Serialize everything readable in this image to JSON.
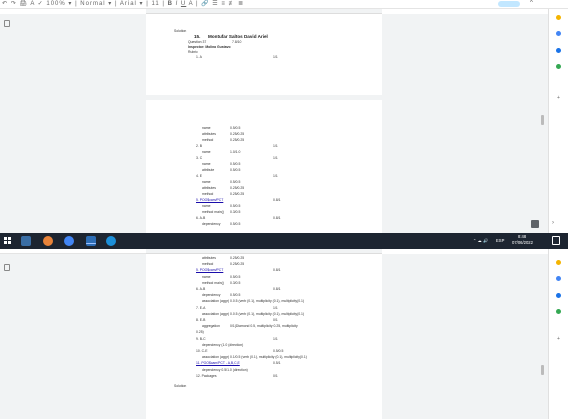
{
  "top_window": {
    "doc": {
      "solution_label": "Solution",
      "question_number": "15.",
      "student_name": "Montufar Saltos David Ariel",
      "question_line": "Question 37",
      "score": "7.8/10",
      "inspector": "Inspector: Molina Gustavo",
      "rubric": "Rubric",
      "item1_label": "1.  A",
      "item1_score": "1/1"
    },
    "page2_lines": [
      {
        "t": "name",
        "v": "0.5/0.5"
      },
      {
        "t": "attributes",
        "v": "0.25/0.25"
      },
      {
        "t": "method",
        "v": "0.25/0.25"
      },
      {
        "t": "2.  B",
        "v": "",
        "s": "1/1"
      },
      {
        "t": "name",
        "v": "1.0/1.0"
      },
      {
        "t": "3.  C",
        "v": "",
        "s": "1/1"
      },
      {
        "t": "name",
        "v": "0.5/0.5"
      },
      {
        "t": "attribute",
        "v": "0.5/0.5"
      },
      {
        "t": "4.  E",
        "v": "",
        "s": "1/1"
      },
      {
        "t": "name",
        "v": "0.5/0.5"
      },
      {
        "t": "attributes",
        "v": "0.25/0.25"
      },
      {
        "t": "method",
        "v": "0.25/0.25"
      },
      {
        "t": "5.  POO$cam/PCT",
        "v": "",
        "s": "0.8/1",
        "link": true
      },
      {
        "t": "name",
        "v": "0.5/0.5"
      },
      {
        "t": "method main()",
        "v": "0.3/0.5"
      },
      {
        "t": "6.  A-B",
        "v": "",
        "s": "0.8/1"
      },
      {
        "t": "dependency",
        "v": "0.5/0.5"
      }
    ]
  },
  "taskbar": {
    "lang": "ESP",
    "time": "8:48",
    "date": "07/06/2022"
  },
  "bottom_window": {
    "lines": [
      {
        "t": "attributes",
        "v": "0.25/0.25"
      },
      {
        "t": "method",
        "v": "0.25/0.25"
      },
      {
        "t": "5.  POO$cam/PCT",
        "v": "",
        "s": "0.8/1",
        "link": true
      },
      {
        "t": "name",
        "v": "0.5/0.5"
      },
      {
        "t": "method main()",
        "v": "0.3/0.5"
      },
      {
        "t": "6.  A-B",
        "v": "",
        "s": "0.8/1"
      },
      {
        "t": "dependency",
        "v": "0.5/0.5"
      },
      {
        "t": "association (aggr)",
        "v": "0.0.5 (verb (0.1), multiplicity (0.1), multiplicity(0.1)"
      },
      {
        "t": "7.  E-A",
        "v": "",
        "s": "1/1"
      },
      {
        "t": "association (aggr)",
        "v": "0.0.5 (verb (0.1), multiplicity (0.1), multiplicity(0.1)"
      },
      {
        "t": "8.  E-B",
        "v": "",
        "s": "0/1"
      },
      {
        "t": "aggregation",
        "v": "0/1(Diamond 0.5, multiplicity 0.25, multiplicity"
      },
      {
        "t": "0.25)",
        "v": ""
      },
      {
        "t": "9.  B-C",
        "v": "",
        "s": "1/1"
      },
      {
        "t": "dependency (1.0 (direction)",
        "v": ""
      },
      {
        "t": "10. C-E",
        "v": "",
        "s": "0.5/0.5"
      },
      {
        "t": "association (aggr)",
        "v": "0.1/0.5 (verb (0.1), multiplicity (0.1), multiplicity(0.1)"
      },
      {
        "t": "11. POO$cam/PCT - A,B,C,E",
        "v": "",
        "s": "0.5/1",
        "link": true
      },
      {
        "t": "dependency  0.5/1.0 (direction)",
        "v": ""
      },
      {
        "t": "12. Packages",
        "v": "",
        "s": "0/1"
      }
    ],
    "solution_label": "Solution"
  },
  "colors": {
    "taskbar": "#1d2531",
    "canvas": "#f1f3f4",
    "link": "#1a0dab"
  }
}
